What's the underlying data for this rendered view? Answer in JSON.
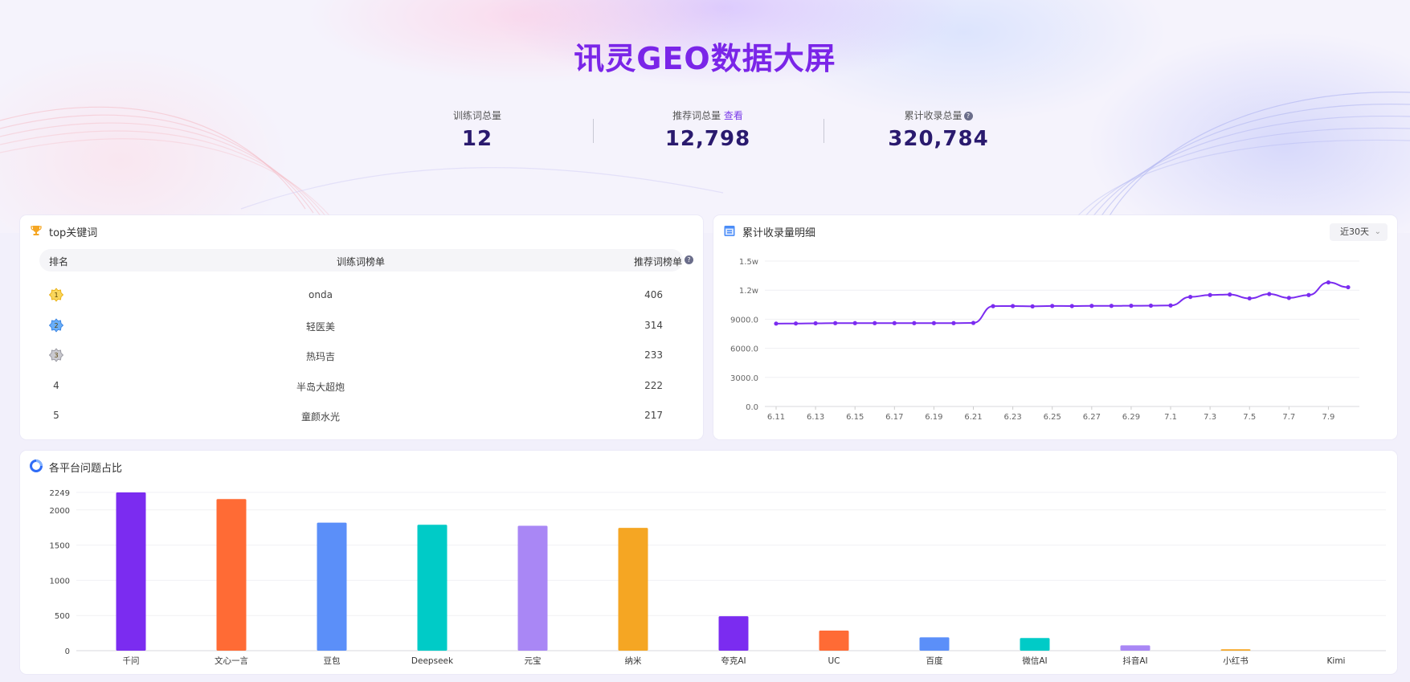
{
  "header": {
    "title": "讯灵GEO数据大屏"
  },
  "stats": [
    {
      "label": "训练词总量",
      "value": "12"
    },
    {
      "label": "推荐词总量",
      "link": "查看",
      "value": "12,798"
    },
    {
      "label": "累计收录总量",
      "value": "320,784",
      "help_icon": "question-icon"
    }
  ],
  "top_keywords": {
    "title": "top关键词",
    "icon": "trophy-icon",
    "columns": [
      "排名",
      "训练词榜单",
      "推荐词榜单"
    ],
    "rows": [
      {
        "rank": "1",
        "word": "onda",
        "count": "406"
      },
      {
        "rank": "2",
        "word": "轻医美",
        "count": "314"
      },
      {
        "rank": "3",
        "word": "热玛吉",
        "count": "233"
      },
      {
        "rank": "4",
        "word": "半岛大超炮",
        "count": "222"
      },
      {
        "rank": "5",
        "word": "童颜水光",
        "count": "217"
      }
    ]
  },
  "cumulative": {
    "title": "累计收录量明细",
    "icon": "calendar-icon",
    "range": "近30天",
    "colors": {
      "line": "#7b2cf0"
    }
  },
  "platforms": {
    "title": "各平台问题占比",
    "icon": "pie-icon"
  },
  "chart_data": [
    {
      "type": "line",
      "title": "累计收录量明细",
      "x_ticks": [
        "6.11",
        "6.13",
        "6.15",
        "6.17",
        "6.19",
        "6.21",
        "6.23",
        "6.25",
        "6.27",
        "6.29",
        "7.1",
        "7.3",
        "7.5",
        "7.7",
        "7.9"
      ],
      "y_ticks": [
        "0.0",
        "3000.0",
        "6000.0",
        "9000.0",
        "1.2w",
        "1.5w"
      ],
      "ylim": [
        0,
        15000
      ],
      "series": [
        {
          "values": [
            8550,
            8560,
            8580,
            8600,
            8600,
            8600,
            8600,
            8600,
            8600,
            8600,
            8620,
            10350,
            10360,
            10330,
            10370,
            10360,
            10380,
            10380,
            10390,
            10400,
            10420,
            11300,
            11500,
            11550,
            11150,
            11600,
            11200,
            11500,
            12800,
            12300
          ]
        }
      ]
    },
    {
      "type": "bar",
      "title": "各平台问题占比",
      "categories": [
        "千问",
        "文心一言",
        "豆包",
        "Deepseek",
        "元宝",
        "纳米",
        "夸克AI",
        "UC",
        "百度",
        "微信AI",
        "抖音AI",
        "小红书",
        "Kimi"
      ],
      "values": [
        2249,
        2155,
        1820,
        1790,
        1775,
        1745,
        490,
        285,
        190,
        180,
        75,
        20,
        0
      ],
      "y_ticks": [
        "0",
        "500",
        "1000",
        "1500",
        "2000",
        "2249"
      ],
      "ylim": [
        0,
        2249
      ],
      "colors": [
        "#7b2cf0",
        "#ff6b35",
        "#5b8ff9",
        "#00cbc7",
        "#a987f5",
        "#f5a623",
        "#7b2cf0",
        "#ff6b35",
        "#5b8ff9",
        "#00cbc7",
        "#a987f5",
        "#f5a623",
        "#5b8ff9"
      ]
    }
  ]
}
